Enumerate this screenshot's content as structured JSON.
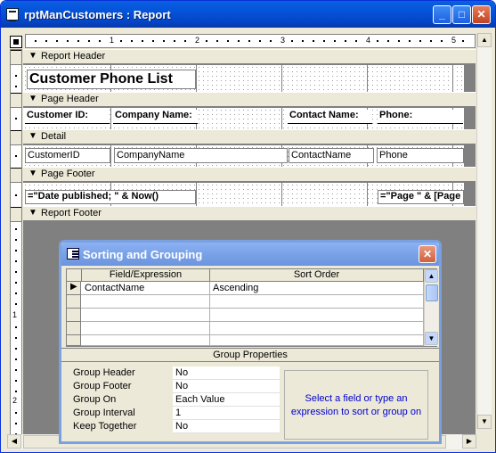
{
  "window": {
    "title": "rptManCustomers : Report",
    "minimize_label": "_",
    "maximize_label": "□",
    "close_label": "✕"
  },
  "ruler": {
    "numbers": [
      "1",
      "2",
      "3",
      "4",
      "5"
    ],
    "vertical_numbers": [
      "1",
      "2"
    ]
  },
  "sections": {
    "report_header": "Report Header",
    "page_header": "Page Header",
    "detail": "Detail",
    "page_footer": "Page Footer",
    "report_footer": "Report Footer"
  },
  "report_title": "Customer Phone List",
  "page_header_labels": [
    "Customer ID:",
    "Company Name:",
    "Contact Name:",
    "Phone:"
  ],
  "detail_fields": [
    "CustomerID",
    "CompanyName",
    "ContactName",
    "Phone"
  ],
  "page_footer_fields": {
    "date": "=\"Date published; \" & Now()",
    "page": "=\"Page \" & [Page"
  },
  "dialog": {
    "title": "Sorting and Grouping",
    "close_label": "✕",
    "columns": [
      "Field/Expression",
      "Sort Order"
    ],
    "rows": [
      {
        "field": "ContactName",
        "sort": "Ascending"
      },
      {
        "field": "",
        "sort": ""
      },
      {
        "field": "",
        "sort": ""
      },
      {
        "field": "",
        "sort": ""
      },
      {
        "field": "",
        "sort": ""
      }
    ],
    "group_properties_title": "Group Properties",
    "properties": [
      {
        "label": "Group Header",
        "value": "No"
      },
      {
        "label": "Group Footer",
        "value": "No"
      },
      {
        "label": "Group On",
        "value": "Each Value"
      },
      {
        "label": "Group Interval",
        "value": "1"
      },
      {
        "label": "Keep Together",
        "value": "No"
      }
    ],
    "help_text": "Select a field or type an expression to sort or group on"
  }
}
